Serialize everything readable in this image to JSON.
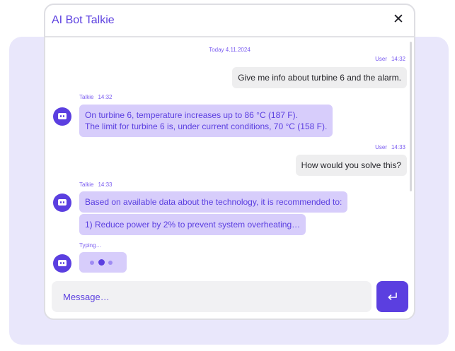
{
  "window": {
    "title": "AI Bot Talkie",
    "close_glyph": "✕"
  },
  "chat": {
    "date": "Today 4.11.2024",
    "messages": [
      {
        "sender": "User",
        "time": "14:32",
        "lines": [
          "Give me info about turbine 6 and the alarm."
        ]
      },
      {
        "sender": "Talkie",
        "time": "14:32",
        "lines": [
          "On turbine 6, temperature increases up to 86 °C (187 F).",
          "The limit for turbine 6 is, under current conditions, 70 °C (158 F)."
        ]
      },
      {
        "sender": "User",
        "time": "14:33",
        "lines": [
          "How would you solve this?"
        ]
      },
      {
        "sender": "Talkie",
        "time": "14:33",
        "lines": [
          "Based on available data about the technology, it is recommended to:"
        ]
      },
      {
        "sender": "Talkie",
        "time": "",
        "lines": [
          "1) Reduce power by 2% to prevent system overheating…"
        ]
      }
    ],
    "typing_label": "Typing…"
  },
  "composer": {
    "placeholder": "Message…",
    "send_icon": "enter-arrow-icon"
  },
  "colors": {
    "accent": "#5b3fe0",
    "bot_bubble": "#d7cdfb",
    "user_bubble": "#eeeeef",
    "backdrop": "#e9e7fb"
  }
}
